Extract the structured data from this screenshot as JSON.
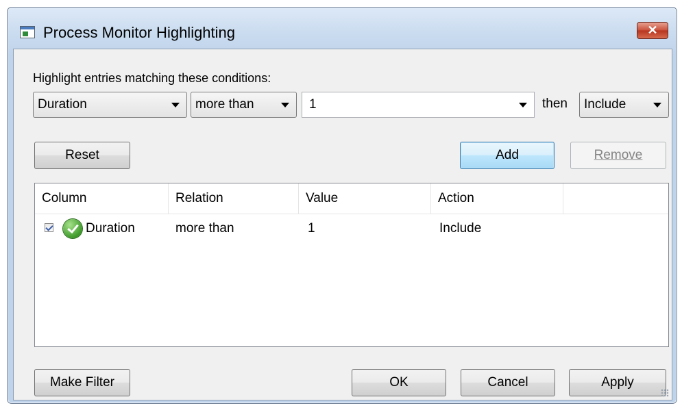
{
  "window": {
    "title": "Process Monitor Highlighting",
    "close_glyph": "✕"
  },
  "conditions": {
    "heading": "Highlight entries matching these conditions:",
    "column_value": "Duration",
    "relation_value": "more than",
    "value_input": "1",
    "then_label": "then",
    "action_value": "Include"
  },
  "buttons": {
    "reset": "Reset",
    "add": "Add",
    "remove": "Remove",
    "make_filter": "Make Filter",
    "ok": "OK",
    "cancel": "Cancel",
    "apply": "Apply"
  },
  "list": {
    "columns": [
      "Column",
      "Relation",
      "Value",
      "Action"
    ],
    "rows": [
      {
        "checked": true,
        "icon": "green-check-icon",
        "column": "Duration",
        "relation": "more than",
        "value": "1",
        "action": "Include"
      }
    ]
  }
}
